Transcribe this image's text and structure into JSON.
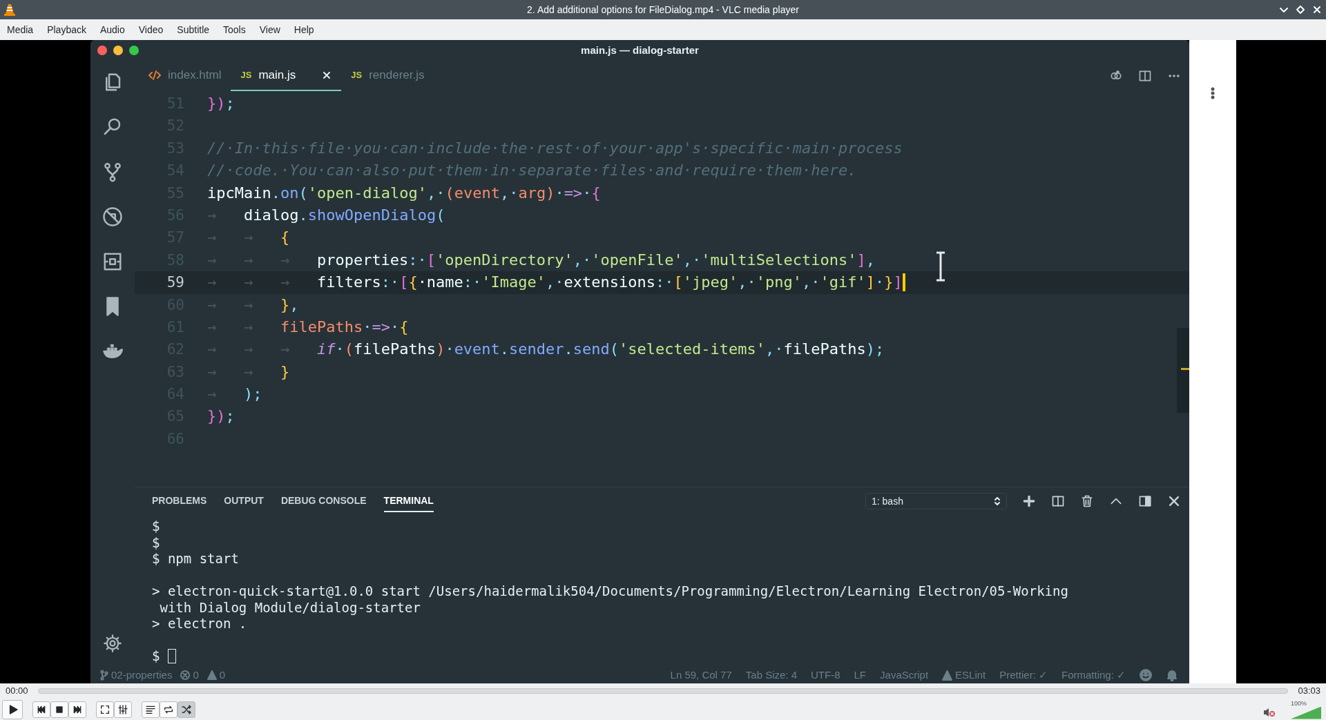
{
  "window": {
    "title": "2. Add additional options for FileDialog.mp4 - VLC media player"
  },
  "menu": [
    "Media",
    "Playback",
    "Audio",
    "Video",
    "Subtitle",
    "Tools",
    "View",
    "Help"
  ],
  "video": {
    "editor_window": {
      "title": "main.js — dialog-starter",
      "tabs": [
        {
          "label": "index.html",
          "kind": "html",
          "selected": false
        },
        {
          "label": "main.js",
          "kind": "js",
          "badge": "JS",
          "selected": true
        },
        {
          "label": "renderer.js",
          "kind": "js",
          "badge": "JS",
          "selected": false
        }
      ],
      "lines": [
        {
          "number": "51",
          "current": false,
          "tokens": [
            {
              "text": "}",
              "kind": "paren"
            },
            {
              "text": ")",
              "kind": "paren"
            },
            {
              "text": ";",
              "kind": "punct"
            }
          ]
        },
        {
          "number": "52",
          "current": false
        },
        {
          "number": "53",
          "current": false,
          "tokens": [
            {
              "text": "//·In·this·file·you·can·include·the·rest·of·your·app's·specific·main·process",
              "kind": "comment"
            }
          ]
        },
        {
          "number": "54",
          "current": false,
          "tokens": [
            {
              "text": "//·code.·You·can·also·put·them·in·separate·files·and·require·them·here.",
              "kind": "comment"
            }
          ]
        },
        {
          "number": "55",
          "current": false,
          "tokens": [
            {
              "text": "ipcMain",
              "kind": "plain"
            },
            {
              "text": ".",
              "kind": "punct"
            },
            {
              "text": "on",
              "kind": "func"
            },
            {
              "text": "(",
              "kind": "punct"
            },
            {
              "text": "'open-dialog'",
              "kind": "string"
            },
            {
              "text": ",·",
              "kind": "punct"
            },
            {
              "text": "(event",
              "kind": "param"
            },
            {
              "text": ",·",
              "kind": "punct"
            },
            {
              "text": "arg)",
              "kind": "param"
            },
            {
              "text": "·",
              "kind": "punct"
            },
            {
              "text": "=>",
              "kind": "op"
            },
            {
              "text": "·",
              "kind": "punct"
            },
            {
              "text": "{",
              "kind": "paren"
            }
          ]
        },
        {
          "number": "56",
          "current": false,
          "tokens": [
            {
              "text": "→",
              "kind": "tab"
            },
            {
              "text": "dialog",
              "kind": "plain"
            },
            {
              "text": ".",
              "kind": "punct"
            },
            {
              "text": "showOpenDialog",
              "kind": "func"
            },
            {
              "text": "(",
              "kind": "punct"
            }
          ]
        },
        {
          "number": "57",
          "current": false,
          "tokens": [
            {
              "text": "→",
              "kind": "tab"
            },
            {
              "text": "→",
              "kind": "tab"
            },
            {
              "text": "{",
              "kind": "brace"
            }
          ]
        },
        {
          "number": "58",
          "current": false,
          "tokens": [
            {
              "text": "→",
              "kind": "tab"
            },
            {
              "text": "→",
              "kind": "tab"
            },
            {
              "text": "→",
              "kind": "tab"
            },
            {
              "text": "properties",
              "kind": "plain"
            },
            {
              "text": ":·",
              "kind": "punct"
            },
            {
              "text": "[",
              "kind": "paren"
            },
            {
              "text": "'openDirectory'",
              "kind": "string"
            },
            {
              "text": ",·",
              "kind": "punct"
            },
            {
              "text": "'openFile'",
              "kind": "string"
            },
            {
              "text": ",·",
              "kind": "punct"
            },
            {
              "text": "'multiSelections'",
              "kind": "string"
            },
            {
              "text": "]",
              "kind": "paren"
            },
            {
              "text": ",",
              "kind": "punct"
            }
          ]
        },
        {
          "number": "59",
          "current": true,
          "tokens": [
            {
              "text": "→",
              "kind": "tab"
            },
            {
              "text": "→",
              "kind": "tab"
            },
            {
              "text": "→",
              "kind": "tab"
            },
            {
              "text": "filters",
              "kind": "plain"
            },
            {
              "text": ":·",
              "kind": "punct"
            },
            {
              "text": "[",
              "kind": "paren"
            },
            {
              "text": "{",
              "kind": "brace"
            },
            {
              "text": "·name",
              "kind": "plain"
            },
            {
              "text": ":·",
              "kind": "punct"
            },
            {
              "text": "'Image'",
              "kind": "string"
            },
            {
              "text": ",·",
              "kind": "punct"
            },
            {
              "text": "extensions",
              "kind": "plain"
            },
            {
              "text": ":·",
              "kind": "punct"
            },
            {
              "text": "[",
              "kind": "brace"
            },
            {
              "text": "'jpeg'",
              "kind": "string"
            },
            {
              "text": ",·",
              "kind": "punct"
            },
            {
              "text": "'png'",
              "kind": "string"
            },
            {
              "text": ",·",
              "kind": "punct"
            },
            {
              "text": "'gif'",
              "kind": "string"
            },
            {
              "text": "]",
              "kind": "brace"
            },
            {
              "text": "·",
              "kind": "punct"
            },
            {
              "text": "}",
              "kind": "brace"
            },
            {
              "text": "]",
              "kind": "paren"
            }
          ]
        },
        {
          "number": "60",
          "current": false,
          "tokens": [
            {
              "text": "→",
              "kind": "tab"
            },
            {
              "text": "→",
              "kind": "tab"
            },
            {
              "text": "}",
              "kind": "brace"
            },
            {
              "text": ",",
              "kind": "punct"
            }
          ]
        },
        {
          "number": "61",
          "current": false,
          "tokens": [
            {
              "text": "→",
              "kind": "tab"
            },
            {
              "text": "→",
              "kind": "tab"
            },
            {
              "text": "filePaths",
              "kind": "param"
            },
            {
              "text": "·",
              "kind": "punct"
            },
            {
              "text": "=>",
              "kind": "op"
            },
            {
              "text": "·",
              "kind": "punct"
            },
            {
              "text": "{",
              "kind": "brace"
            }
          ]
        },
        {
          "number": "62",
          "current": false,
          "tokens": [
            {
              "text": "→",
              "kind": "tab"
            },
            {
              "text": "→",
              "kind": "tab"
            },
            {
              "text": "→",
              "kind": "tab"
            },
            {
              "text": "if",
              "kind": "keyword"
            },
            {
              "text": "·",
              "kind": "punct"
            },
            {
              "text": "(",
              "kind": "param"
            },
            {
              "text": "filePaths",
              "kind": "plain"
            },
            {
              "text": ")",
              "kind": "param"
            },
            {
              "text": "·",
              "kind": "punct"
            },
            {
              "text": "event",
              "kind": "func"
            },
            {
              "text": ".",
              "kind": "punct"
            },
            {
              "text": "sender",
              "kind": "func"
            },
            {
              "text": ".",
              "kind": "punct"
            },
            {
              "text": "send",
              "kind": "func"
            },
            {
              "text": "(",
              "kind": "punct"
            },
            {
              "text": "'selected-items'",
              "kind": "string"
            },
            {
              "text": ",·",
              "kind": "punct"
            },
            {
              "text": "filePaths",
              "kind": "plain"
            },
            {
              "text": ");",
              "kind": "punct"
            }
          ]
        },
        {
          "number": "63",
          "current": false,
          "tokens": [
            {
              "text": "→",
              "kind": "tab"
            },
            {
              "text": "→",
              "kind": "tab"
            },
            {
              "text": "}",
              "kind": "brace"
            }
          ]
        },
        {
          "number": "64",
          "current": false,
          "tokens": [
            {
              "text": "→",
              "kind": "tab"
            },
            {
              "text": ");",
              "kind": "punct"
            }
          ]
        },
        {
          "number": "65",
          "current": false,
          "tokens": [
            {
              "text": "}",
              "kind": "paren"
            },
            {
              "text": ")",
              "kind": "paren"
            },
            {
              "text": ";",
              "kind": "punct"
            }
          ]
        },
        {
          "number": "66",
          "current": false
        }
      ],
      "panel": {
        "tabs": [
          {
            "label": "PROBLEMS",
            "selected": false
          },
          {
            "label": "OUTPUT",
            "selected": false
          },
          {
            "label": "DEBUG CONSOLE",
            "selected": false
          },
          {
            "label": "TERMINAL",
            "selected": true
          }
        ],
        "terminal_select": "1: bash",
        "terminal": [
          {
            "kind": "line",
            "text": "$"
          },
          {
            "kind": "line",
            "text": "$"
          },
          {
            "kind": "line",
            "text": "$ npm start"
          },
          {
            "kind": "gap"
          },
          {
            "kind": "line",
            "text": "> electron-quick-start@1.0.0 start /Users/haidermalik504/Documents/Programming/Electron/Learning Electron/05-Working"
          },
          {
            "kind": "continued",
            "text": "with Dialog Module/dialog-starter"
          },
          {
            "kind": "line",
            "text": "> electron ."
          },
          {
            "kind": "gap"
          },
          {
            "kind": "input",
            "text": "$"
          }
        ]
      },
      "status_bar": {
        "left": [
          {
            "kind": "branch",
            "text": "02-properties"
          },
          {
            "kind": "errors",
            "text": "0"
          },
          {
            "kind": "warnings",
            "text": "0"
          }
        ],
        "right": [
          {
            "kind": "text",
            "text": "Ln 59, Col 77"
          },
          {
            "kind": "text",
            "text": "Tab Size: 4"
          },
          {
            "kind": "text",
            "text": "UTF-8"
          },
          {
            "kind": "text",
            "text": "LF"
          },
          {
            "kind": "text",
            "text": "JavaScript"
          },
          {
            "kind": "lint",
            "text": "ESLint"
          },
          {
            "kind": "text",
            "text": "Prettier: ✓"
          },
          {
            "kind": "text",
            "text": "Formatting: ✓"
          },
          {
            "kind": "feedback"
          },
          {
            "kind": "notifications"
          }
        ]
      }
    }
  },
  "player": {
    "elapsed": "00:00",
    "duration": "03:03",
    "position": {
      "level": 0
    },
    "controls": [
      {
        "kind": "play"
      },
      {
        "kind": "previous"
      },
      {
        "kind": "stop"
      },
      {
        "kind": "next"
      },
      {
        "kind": "fullscreen"
      },
      {
        "kind": "extended"
      },
      {
        "kind": "playlist"
      },
      {
        "kind": "loop",
        "on": false
      },
      {
        "kind": "random",
        "on": true
      }
    ],
    "muted": true,
    "volume": {
      "label": "100%",
      "level": 1
    }
  }
}
